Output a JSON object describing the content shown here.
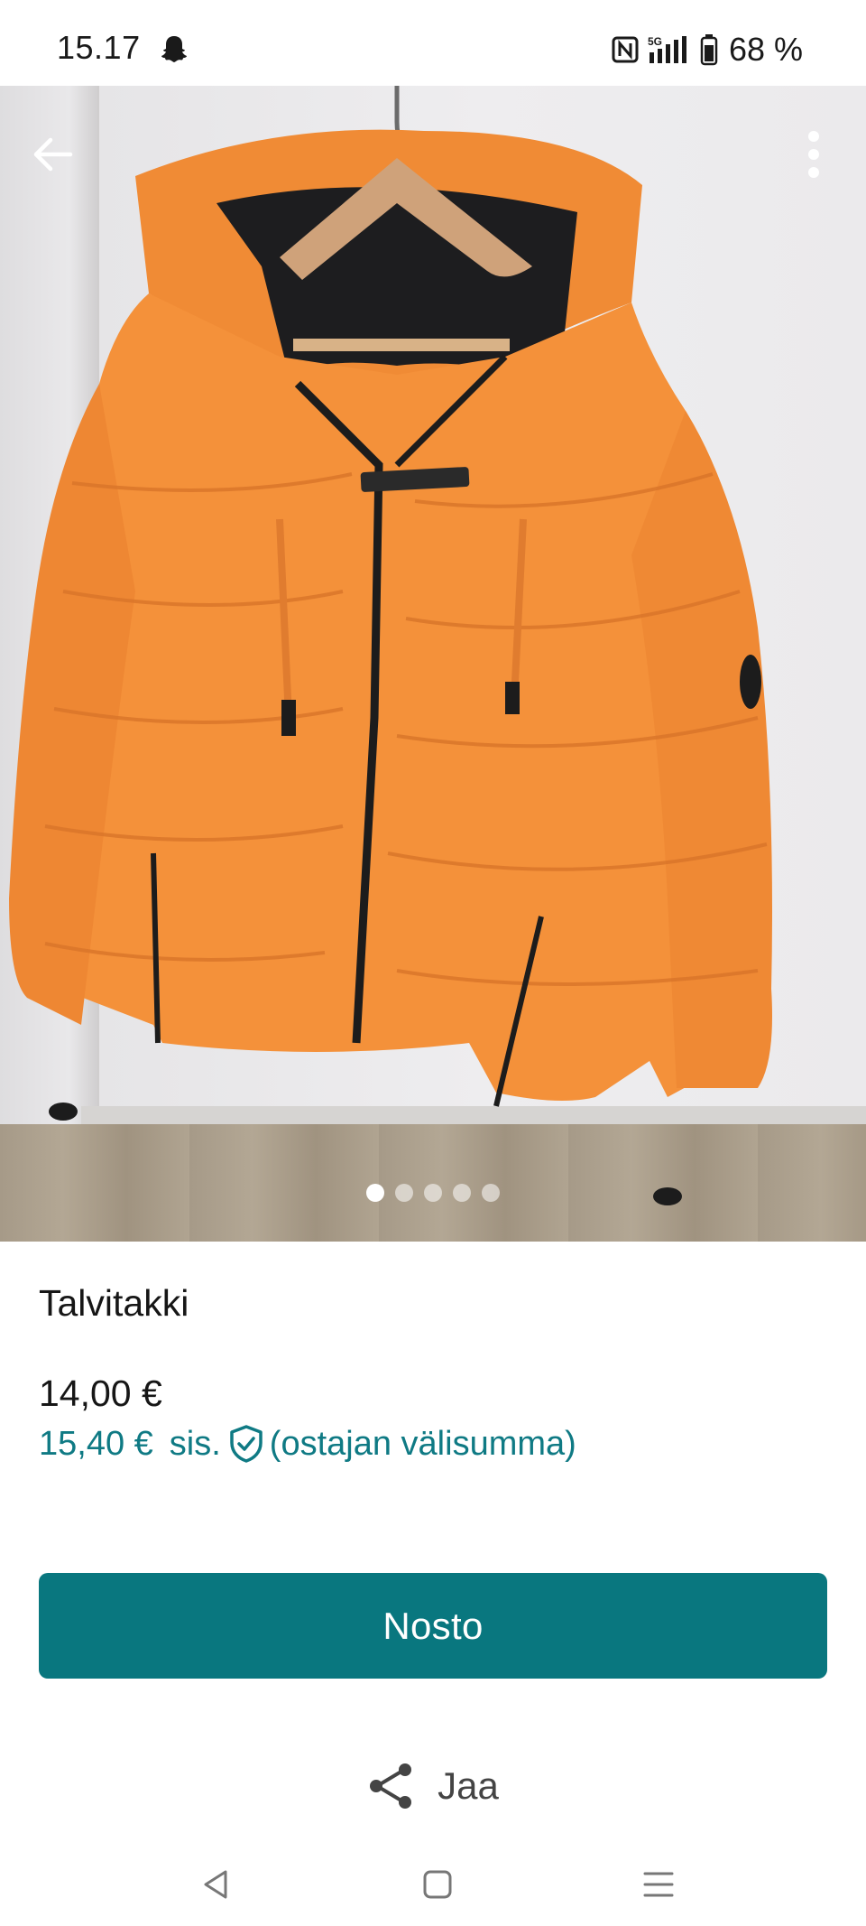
{
  "status_bar": {
    "time": "15.17",
    "battery": "68 %",
    "network": "5G",
    "icons": [
      "snapchat-ghost-icon",
      "nfc-icon",
      "signal-icon",
      "battery-icon"
    ]
  },
  "photo": {
    "image_count": 5,
    "active_index": 0,
    "back_icon": "arrow-left-icon",
    "menu_icon": "more-vertical-icon"
  },
  "listing": {
    "title": "Talvitakki",
    "price": "14,00 €",
    "buyer_price_amount": "15,40 €",
    "buyer_price_incl": "sis.",
    "buyer_price_note": "(ostajan välisumma)",
    "protection_icon": "shield-check-icon"
  },
  "actions": {
    "primary_label": "Nosto",
    "share_label": "Jaa",
    "share_icon": "share-icon"
  },
  "nav_bar": {
    "items": [
      "back-nav-icon",
      "home-nav-icon",
      "recents-nav-icon"
    ]
  },
  "colors": {
    "accent": "#09777f",
    "accent_text": "#0f7a84",
    "jacket": "#f4913a"
  }
}
